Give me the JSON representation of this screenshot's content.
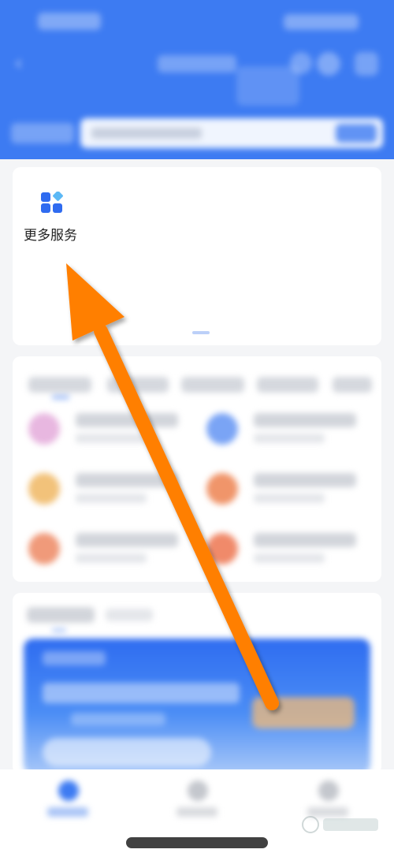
{
  "more_services": {
    "label": "更多服务"
  },
  "colors": {
    "header_blue": "#3d7bf2",
    "arrow_orange": "#ff7f00",
    "icon_blue": "#2f6bf0",
    "icon_light_blue": "#5bb8f5"
  },
  "icons": {
    "more_services": "grid-icon",
    "back": "chevron-left-icon",
    "arrow": "arrow-annotation"
  }
}
